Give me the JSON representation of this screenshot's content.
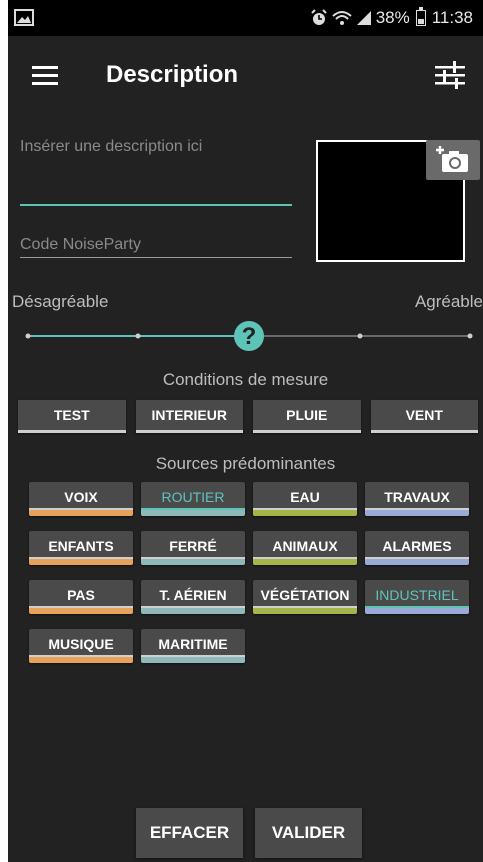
{
  "status_bar": {
    "battery": "38%",
    "time": "11:38"
  },
  "app_bar": {
    "title": "Description"
  },
  "form": {
    "description_placeholder": "Insérer une description ici",
    "code_placeholder": "Code NoiseParty"
  },
  "slider": {
    "left_label": "Désagréable",
    "right_label": "Agréable",
    "thumb_symbol": "?",
    "value_fraction": 0.5
  },
  "conditions": {
    "heading": "Conditions de mesure",
    "buttons": [
      "TEST",
      "INTERIEUR",
      "PLUIE",
      "VENT"
    ]
  },
  "sources": {
    "heading": "Sources prédominantes",
    "buttons": [
      {
        "label": "VOIX",
        "color": "#e8a15a",
        "active": false
      },
      {
        "label": "ROUTIER",
        "color": "#8fb8b8",
        "active": true
      },
      {
        "label": "EAU",
        "color": "#a6b54a",
        "active": false
      },
      {
        "label": "TRAVAUX",
        "color": "#9aaad6",
        "active": false
      },
      {
        "label": "ENFANTS",
        "color": "#e8a15a",
        "active": false
      },
      {
        "label": "FERRÉ",
        "color": "#8fb8b8",
        "active": false
      },
      {
        "label": "ANIMAUX",
        "color": "#a6b54a",
        "active": false
      },
      {
        "label": "ALARMES",
        "color": "#9aaad6",
        "active": false
      },
      {
        "label": "PAS",
        "color": "#e8a15a",
        "active": false
      },
      {
        "label": "T. AÉRIEN",
        "color": "#8fb8b8",
        "active": false
      },
      {
        "label": "VÉGÉTATION",
        "color": "#a6b54a",
        "active": false
      },
      {
        "label": "INDUSTRIEL",
        "color": "#9aaad6",
        "active": true
      },
      {
        "label": "MUSIQUE",
        "color": "#e8a15a",
        "active": false
      },
      {
        "label": "MARITIME",
        "color": "#8fb8b8",
        "active": false
      }
    ]
  },
  "actions": {
    "clear_label": "EFFACER",
    "validate_label": "VALIDER"
  },
  "colors": {
    "accent": "#5fc4b8",
    "background": "#222222",
    "button": "#4a4a4a"
  }
}
